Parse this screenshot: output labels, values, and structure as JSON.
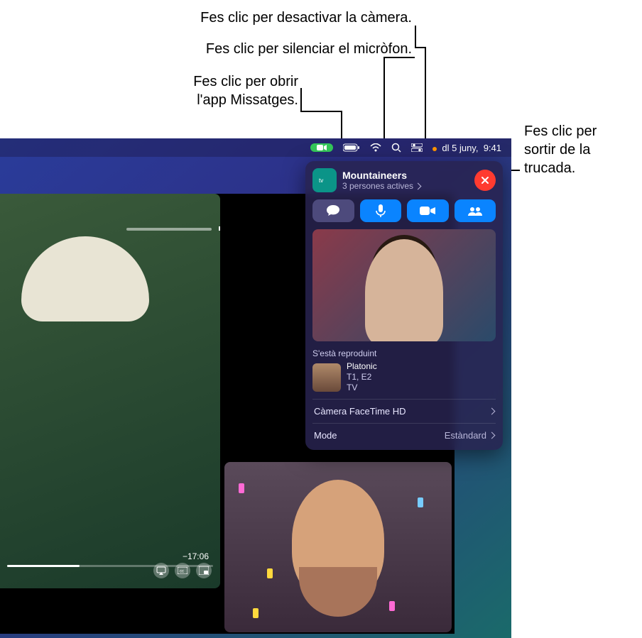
{
  "callouts": {
    "camera": "Fes clic per desactivar la càmera.",
    "mic": "Fes clic per silenciar el micròfon.",
    "messages_l1": "Fes clic per obrir",
    "messages_l2": "l'app Missatges.",
    "leave_l1": "Fes clic per",
    "leave_l2": "sortir de la",
    "leave_l3": "trucada."
  },
  "menubar": {
    "date": "dl 5 juny,",
    "time": "9:41"
  },
  "panel": {
    "title": "Mountaineers",
    "subtitle": "3 persones actives",
    "now_playing_label": "S'està reproduint",
    "media": {
      "title": "Platonic",
      "line2": "T1, E2",
      "line3": "TV"
    },
    "rows": {
      "camera_label": "Càmera FaceTime HD",
      "mode_label": "Mode",
      "mode_value": "Estàndard"
    }
  },
  "player": {
    "time_remaining": "−17:06"
  },
  "icons": {
    "messages": "messages-icon",
    "mic": "mic-icon",
    "video": "video-icon",
    "shareplay": "shareplay-icon",
    "close": "close-icon",
    "facetime_menubar": "facetime-menubar-icon"
  }
}
